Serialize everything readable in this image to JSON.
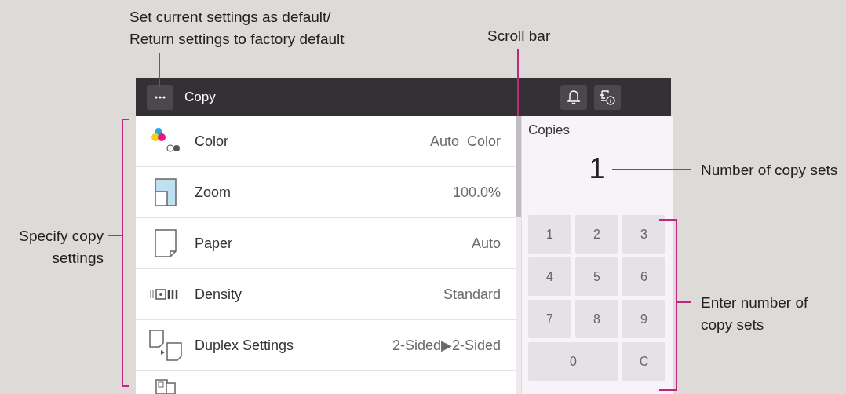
{
  "header": {
    "title": "Copy"
  },
  "settings": [
    {
      "kind": "color",
      "label": "Color",
      "value": "Auto  Color"
    },
    {
      "kind": "zoom",
      "label": "Zoom",
      "value": "100.0%"
    },
    {
      "kind": "paper",
      "label": "Paper",
      "value": "Auto"
    },
    {
      "kind": "density",
      "label": "Density",
      "value": "Standard"
    },
    {
      "kind": "duplex",
      "label": "Duplex  Settings",
      "value": "2-Sided▶2-Sided"
    },
    {
      "kind": "combine"
    }
  ],
  "copies": {
    "label": "Copies",
    "value": "1"
  },
  "keypad": [
    {
      "label": "1",
      "kind": "key"
    },
    {
      "label": "2",
      "kind": "key"
    },
    {
      "label": "3",
      "kind": "key"
    },
    {
      "label": "4",
      "kind": "key"
    },
    {
      "label": "5",
      "kind": "key"
    },
    {
      "label": "6",
      "kind": "key"
    },
    {
      "label": "7",
      "kind": "key"
    },
    {
      "label": "8",
      "kind": "key"
    },
    {
      "label": "9",
      "kind": "key"
    },
    {
      "label": "0",
      "kind": "wide"
    },
    {
      "label": "C",
      "kind": "key"
    }
  ],
  "callouts": [
    {
      "lines": [
        "Set current settings as default/",
        "Return settings to factory default"
      ]
    },
    {
      "lines": [
        "Scroll bar"
      ]
    },
    {
      "lines": [
        "Number of copy sets"
      ]
    },
    {
      "lines": [
        "Specify copy",
        "settings"
      ]
    },
    {
      "lines": [
        "Enter number of",
        "copy sets"
      ]
    }
  ]
}
